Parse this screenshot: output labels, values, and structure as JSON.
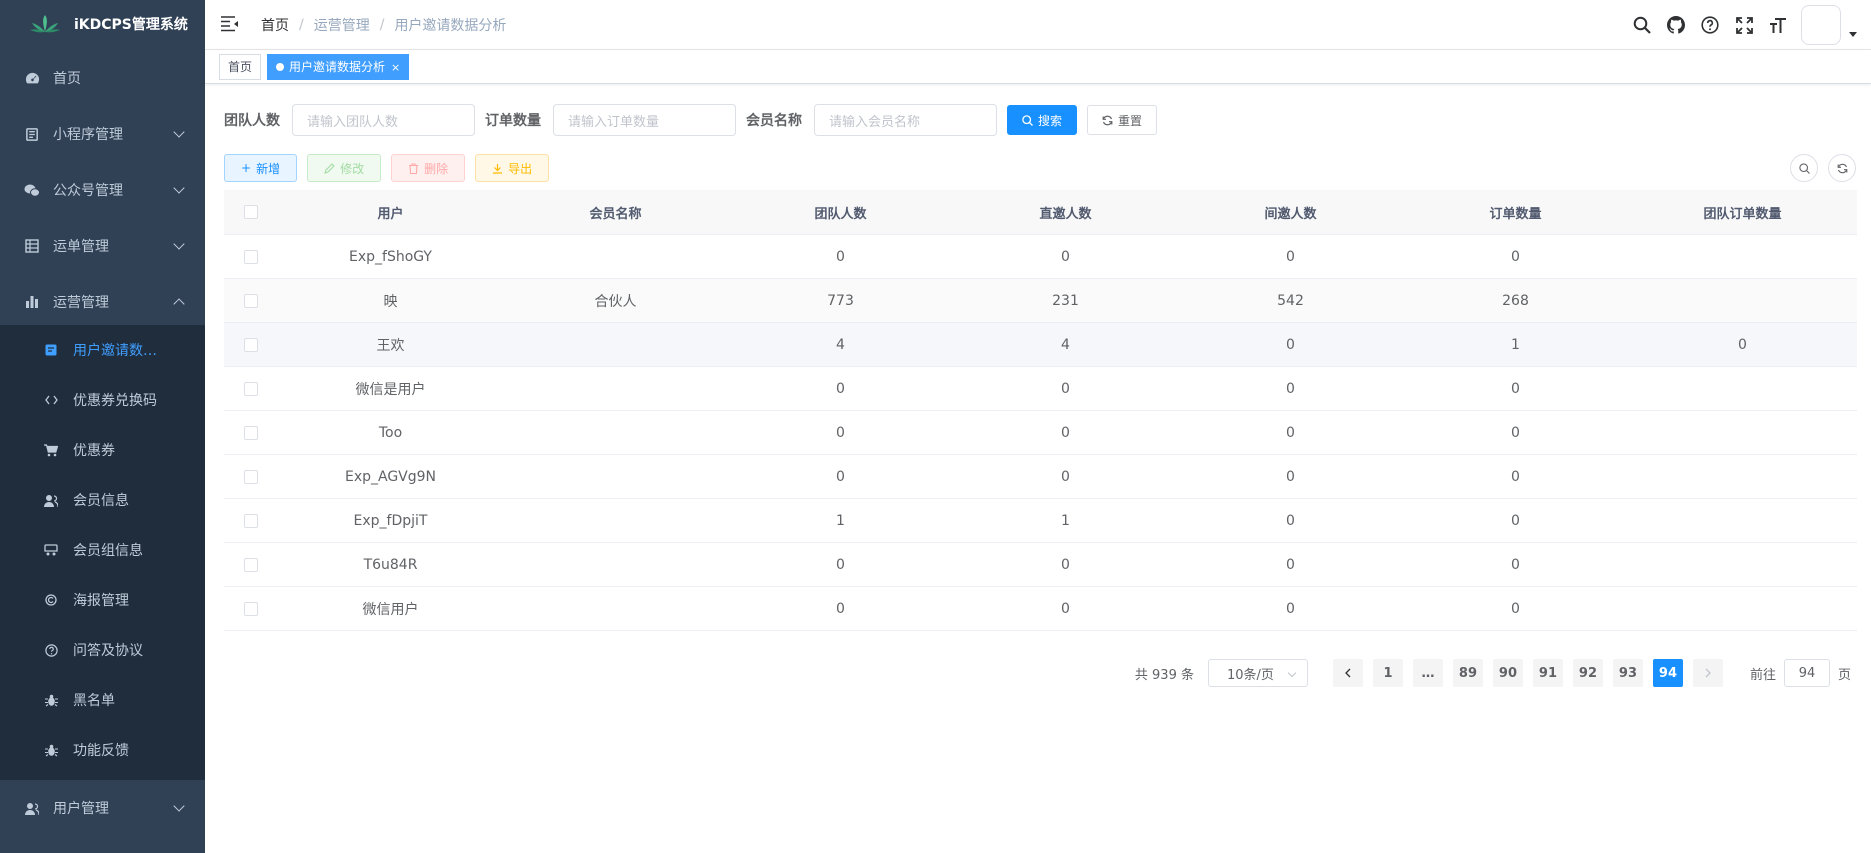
{
  "app": {
    "title": "iKDCPS管理系统"
  },
  "sidebar": {
    "items": [
      {
        "label": "首页",
        "icon": "dashboard-icon"
      },
      {
        "label": "小程序管理",
        "icon": "miniprogram-icon"
      },
      {
        "label": "公众号管理",
        "icon": "wechat-icon"
      },
      {
        "label": "运单管理",
        "icon": "table-icon"
      },
      {
        "label": "运营管理",
        "icon": "chart-icon"
      },
      {
        "label": "用户管理",
        "icon": "user-icon"
      }
    ],
    "subitems": [
      {
        "label": "用户邀请数…",
        "icon": "invite-icon"
      },
      {
        "label": "优惠券兑换码",
        "icon": "code-icon"
      },
      {
        "label": "优惠券",
        "icon": "cart-icon"
      },
      {
        "label": "会员信息",
        "icon": "member-icon"
      },
      {
        "label": "会员组信息",
        "icon": "group-icon"
      },
      {
        "label": "海报管理",
        "icon": "poster-icon"
      },
      {
        "label": "问答及协议",
        "icon": "question-icon"
      },
      {
        "label": "黑名单",
        "icon": "bug-icon"
      },
      {
        "label": "功能反馈",
        "icon": "bug-icon"
      }
    ]
  },
  "breadcrumb": {
    "items": [
      "首页",
      "运营管理",
      "用户邀请数据分析"
    ],
    "sep": "/"
  },
  "tags": {
    "home": "首页",
    "active": "用户邀请数据分析",
    "close": "×"
  },
  "search": {
    "team_label": "团队人数",
    "team_placeholder": "请输入团队人数",
    "order_label": "订单数量",
    "order_placeholder": "请输入订单数量",
    "member_label": "会员名称",
    "member_placeholder": "请输入会员名称",
    "search_btn": "搜索",
    "reset_btn": "重置"
  },
  "toolbar": {
    "add": "新增",
    "edit": "修改",
    "delete": "删除",
    "export": "导出"
  },
  "table": {
    "headers": [
      "用户",
      "会员名称",
      "团队人数",
      "直邀人数",
      "间邀人数",
      "订单数量",
      "团队订单数量"
    ],
    "rows": [
      [
        "Exp_fShoGY",
        "",
        "0",
        "0",
        "0",
        "0",
        ""
      ],
      [
        "映",
        "合伙人",
        "773",
        "231",
        "542",
        "268",
        ""
      ],
      [
        "王欢",
        "",
        "4",
        "4",
        "0",
        "1",
        "0"
      ],
      [
        "微信是用户",
        "",
        "0",
        "0",
        "0",
        "0",
        ""
      ],
      [
        "Too",
        "",
        "0",
        "0",
        "0",
        "0",
        ""
      ],
      [
        "Exp_AGVg9N",
        "",
        "0",
        "0",
        "0",
        "0",
        ""
      ],
      [
        "Exp_fDpjiT",
        "",
        "1",
        "1",
        "0",
        "0",
        ""
      ],
      [
        "T6u84R",
        "",
        "0",
        "0",
        "0",
        "0",
        ""
      ],
      [
        "微信用户",
        "",
        "0",
        "0",
        "0",
        "0",
        ""
      ]
    ]
  },
  "pagination": {
    "total": "共 939 条",
    "page_size": "10条/页",
    "pages": [
      "1",
      "…",
      "89",
      "90",
      "91",
      "92",
      "93",
      "94"
    ],
    "current": "94",
    "goto_label": "前往",
    "goto_value": "94",
    "goto_suffix": "页"
  },
  "colors": {
    "sidebar_bg": "#304156",
    "submenu_bg": "#1f2d3d",
    "primary": "#1890ff",
    "active_text": "#409eff"
  }
}
